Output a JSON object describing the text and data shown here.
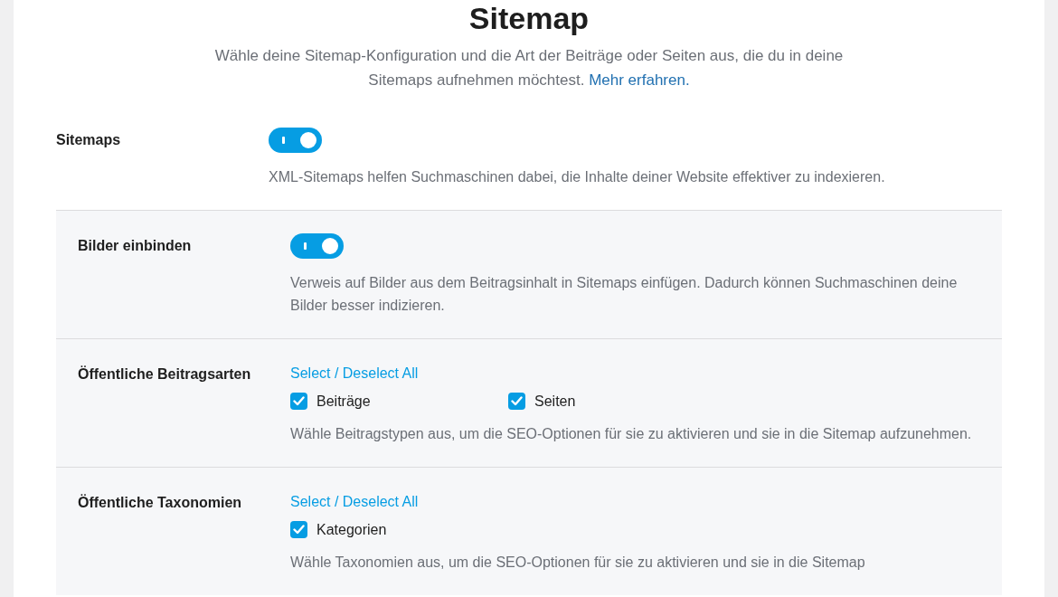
{
  "title": "Sitemap",
  "intro": {
    "text": "Wähle deine Sitemap-Konfiguration und die Art der Beiträge oder Seiten aus, die du in deine Sitemaps aufnehmen möchtest.",
    "link": "Mehr erfahren."
  },
  "main_setting": {
    "label": "Sitemaps",
    "kind": "toggle",
    "on": true,
    "description": "XML-Sitemaps helfen Suchmaschinen dabei, die Inhalte deiner Website effektiver zu indexieren."
  },
  "sub_settings": [
    {
      "label": "Bilder einbinden",
      "kind": "toggle",
      "on": true,
      "description": "Verweis auf Bilder aus dem Beitragsinhalt in Sitemaps einfügen. Dadurch können Suchmaschinen deine Bilder besser indizieren."
    },
    {
      "label": "Öffentliche Beitragsarten",
      "kind": "checklist",
      "select_all": "Select / Deselect All",
      "options": [
        {
          "label": "Beiträge",
          "checked": true
        },
        {
          "label": "Seiten",
          "checked": true
        }
      ],
      "description": "Wähle Beitragstypen aus, um die SEO-Optionen für sie zu aktivieren und sie in die Sitemap aufzunehmen."
    },
    {
      "label": "Öffentliche Taxonomien",
      "kind": "checklist",
      "select_all": "Select / Deselect All",
      "options": [
        {
          "label": "Kategorien",
          "checked": true
        }
      ],
      "description": "Wähle Taxonomien aus, um die SEO-Optionen für sie zu aktivieren und sie in die Sitemap"
    }
  ]
}
